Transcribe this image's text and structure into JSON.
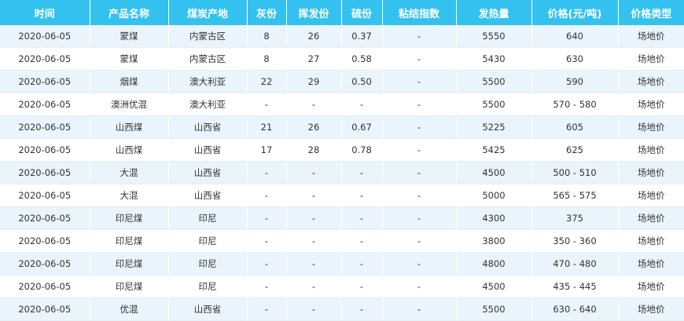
{
  "table": {
    "columns": [
      "时间",
      "产品名称",
      "煤炭产地",
      "灰份",
      "挥发份",
      "硫份",
      "粘结指数",
      "发热量",
      "价格(元/吨)",
      "价格类型"
    ],
    "rows": [
      [
        "2020-06-05",
        "蒙煤",
        "内蒙古区",
        "8",
        "26",
        "0.37",
        "-",
        "5550",
        "640",
        "场地价"
      ],
      [
        "2020-06-05",
        "蒙煤",
        "内蒙古区",
        "8",
        "27",
        "0.58",
        "-",
        "5430",
        "630",
        "场地价"
      ],
      [
        "2020-06-05",
        "烟煤",
        "澳大利亚",
        "22",
        "29",
        "0.50",
        "-",
        "5500",
        "590",
        "场地价"
      ],
      [
        "2020-06-05",
        "澳洲优混",
        "澳大利亚",
        "-",
        "-",
        "-",
        "-",
        "5500",
        "570 - 580",
        "场地价"
      ],
      [
        "2020-06-05",
        "山西煤",
        "山西省",
        "21",
        "26",
        "0.67",
        "-",
        "5225",
        "605",
        "场地价"
      ],
      [
        "2020-06-05",
        "山西煤",
        "山西省",
        "17",
        "28",
        "0.78",
        "-",
        "5425",
        "625",
        "场地价"
      ],
      [
        "2020-06-05",
        "大混",
        "山西省",
        "-",
        "-",
        "-",
        "-",
        "4500",
        "500 - 510",
        "场地价"
      ],
      [
        "2020-06-05",
        "大混",
        "山西省",
        "-",
        "-",
        "-",
        "-",
        "5000",
        "565 - 575",
        "场地价"
      ],
      [
        "2020-06-05",
        "印尼煤",
        "印尼",
        "-",
        "-",
        "-",
        "-",
        "4300",
        "375",
        "场地价"
      ],
      [
        "2020-06-05",
        "印尼煤",
        "印尼",
        "-",
        "-",
        "-",
        "-",
        "3800",
        "350 - 360",
        "场地价"
      ],
      [
        "2020-06-05",
        "印尼煤",
        "印尼",
        "-",
        "-",
        "-",
        "-",
        "4800",
        "470 - 480",
        "场地价"
      ],
      [
        "2020-06-05",
        "印尼煤",
        "印尼",
        "-",
        "-",
        "-",
        "-",
        "4500",
        "435 - 445",
        "场地价"
      ],
      [
        "2020-06-05",
        "优混",
        "山西省",
        "-",
        "-",
        "-",
        "-",
        "5500",
        "630 - 640",
        "场地价"
      ]
    ]
  },
  "colors": {
    "header_bg": "#33c2ef",
    "header_text": "#ffffff",
    "row_stripe": "#eaf4fc",
    "row_plain": "#ffffff",
    "cell_text": "#333333"
  }
}
